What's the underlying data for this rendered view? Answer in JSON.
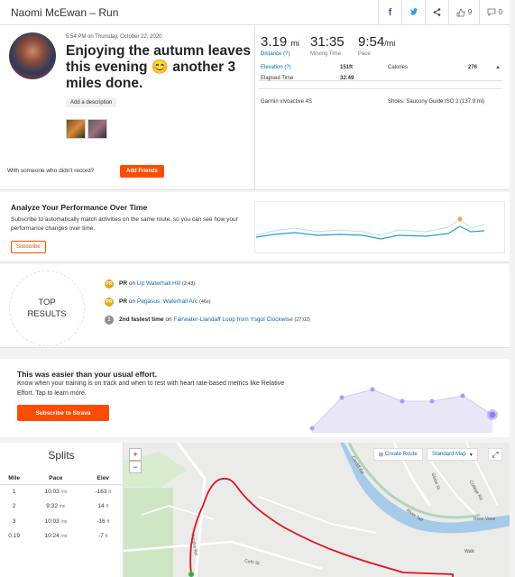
{
  "header": {
    "title": "Naomi McEwan – Run",
    "kudos_count": "9",
    "comment_count": "0",
    "icons": [
      "facebook-icon",
      "twitter-icon",
      "share-icon",
      "kudos-icon",
      "comment-icon"
    ]
  },
  "activity": {
    "datetime": "5:54 PM on Thursday, October 22, 2020",
    "title": "Enjoying the autumn leaves this evening 😊 another 3 miles done.",
    "add_description": "Add a description",
    "friends_prompt": "With someone who didn't record?",
    "add_friends": "Add Friends"
  },
  "stats": {
    "distance_value": "3.19",
    "distance_unit": "mi",
    "distance_label": "Distance",
    "moving_time_value": "31:35",
    "moving_time_label": "Moving Time",
    "pace_value": "9:54",
    "pace_unit": "/mi",
    "pace_label": "Pace",
    "elevation_label": "Elevation",
    "elevation_value": "151ft",
    "calories_label": "Calories",
    "calories_value": "276",
    "elapsed_label": "Elapsed Time",
    "elapsed_value": "32:49",
    "device": "Garmin vívoactive 4S",
    "shoes": "Shoes: Saucony Guide ISO 2 (137.9 mi)",
    "info_mark": "(?)"
  },
  "analyze": {
    "title": "Analyze Your Performance Over Time",
    "text": "Subscribe to automatically match activities on the same route, so you can see how your performance changes over time.",
    "button": "Subscribe"
  },
  "achievements": {
    "badge_line1": "TOP",
    "badge_line2": "RESULTS",
    "items": [
      {
        "medal": "PR",
        "label": "PR",
        "on": "on",
        "segment": "Up Waterhall Hill",
        "time": "(2:43)",
        "color": "#e6a817"
      },
      {
        "medal": "PR",
        "label": "PR",
        "on": "on",
        "segment": "Pegasus: Waterhall Arc",
        "time": "(46s)",
        "color": "#e6a817"
      },
      {
        "medal": "2",
        "label": "2nd fastest time",
        "on": "on",
        "segment": "Fairwater-Llandaff Loop from Ysgol Clockwise",
        "time": "(27:02)",
        "color": "#8c8c8c"
      }
    ]
  },
  "relative_effort": {
    "title": "This was easier than your usual effort.",
    "text": "Know when your training is on track and when to rest with heart rate-based metrics like Relative Effort. Tap to learn more.",
    "button": "Subscribe to Strava"
  },
  "splits": {
    "title": "Splits",
    "columns": [
      "Mile",
      "Pace",
      "Elev"
    ],
    "rows": [
      {
        "mile": "1",
        "pace": "10:03",
        "pace_unit": "/mi",
        "elev": "-163",
        "elev_unit": "ft"
      },
      {
        "mile": "2",
        "pace": "9:32",
        "pace_unit": "/mi",
        "elev": "14",
        "elev_unit": "ft"
      },
      {
        "mile": "3",
        "pace": "10:03",
        "pace_unit": "/mi",
        "elev": "-16",
        "elev_unit": "ft"
      },
      {
        "mile": "0.19",
        "pace": "10:24",
        "pace_unit": "/mi",
        "elev": "-7",
        "elev_unit": "ft"
      }
    ]
  },
  "map": {
    "zoom_in": "+",
    "zoom_out": "−",
    "create_route": "Create Route",
    "map_type": "Standard Map",
    "fullscreen": "⤢",
    "labels": [
      "River Taff",
      "Glebe St",
      "Pendre Rd",
      "River View",
      "Cardiff Rd",
      "College Rd",
      "Walk",
      "Cefn St"
    ]
  }
}
